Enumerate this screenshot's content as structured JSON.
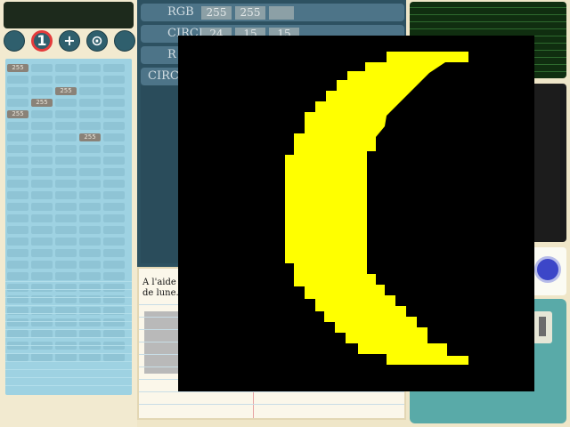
{
  "app": {
    "left_tools": [
      {
        "icon": "circle-icon",
        "glyph": ""
      },
      {
        "icon": "one-icon",
        "glyph": "1",
        "selected": true
      },
      {
        "icon": "plus-icon",
        "glyph": "+"
      },
      {
        "icon": "target-icon",
        "glyph": "⊙"
      },
      {
        "icon": "circle-icon",
        "glyph": ""
      }
    ],
    "grid_marks": [
      "255",
      "255",
      "255",
      "255",
      "255"
    ]
  },
  "controls": {
    "rows": [
      {
        "label": "RGB",
        "values": [
          "255",
          "255",
          ""
        ]
      },
      {
        "label": "CIRCLE",
        "values": [
          "24",
          "15",
          "15"
        ]
      },
      {
        "label": "R",
        "values": []
      },
      {
        "label": "CIRC",
        "values": []
      }
    ]
  },
  "note": {
    "text": "A l'aide de\nde lune."
  },
  "preview": {
    "background_color": "#000000",
    "moon_color": "#FFFF00"
  },
  "colors": {
    "accent_blue": "#3C46C8",
    "selected_ring": "#E43B3B",
    "teal": "#59AAA8"
  }
}
